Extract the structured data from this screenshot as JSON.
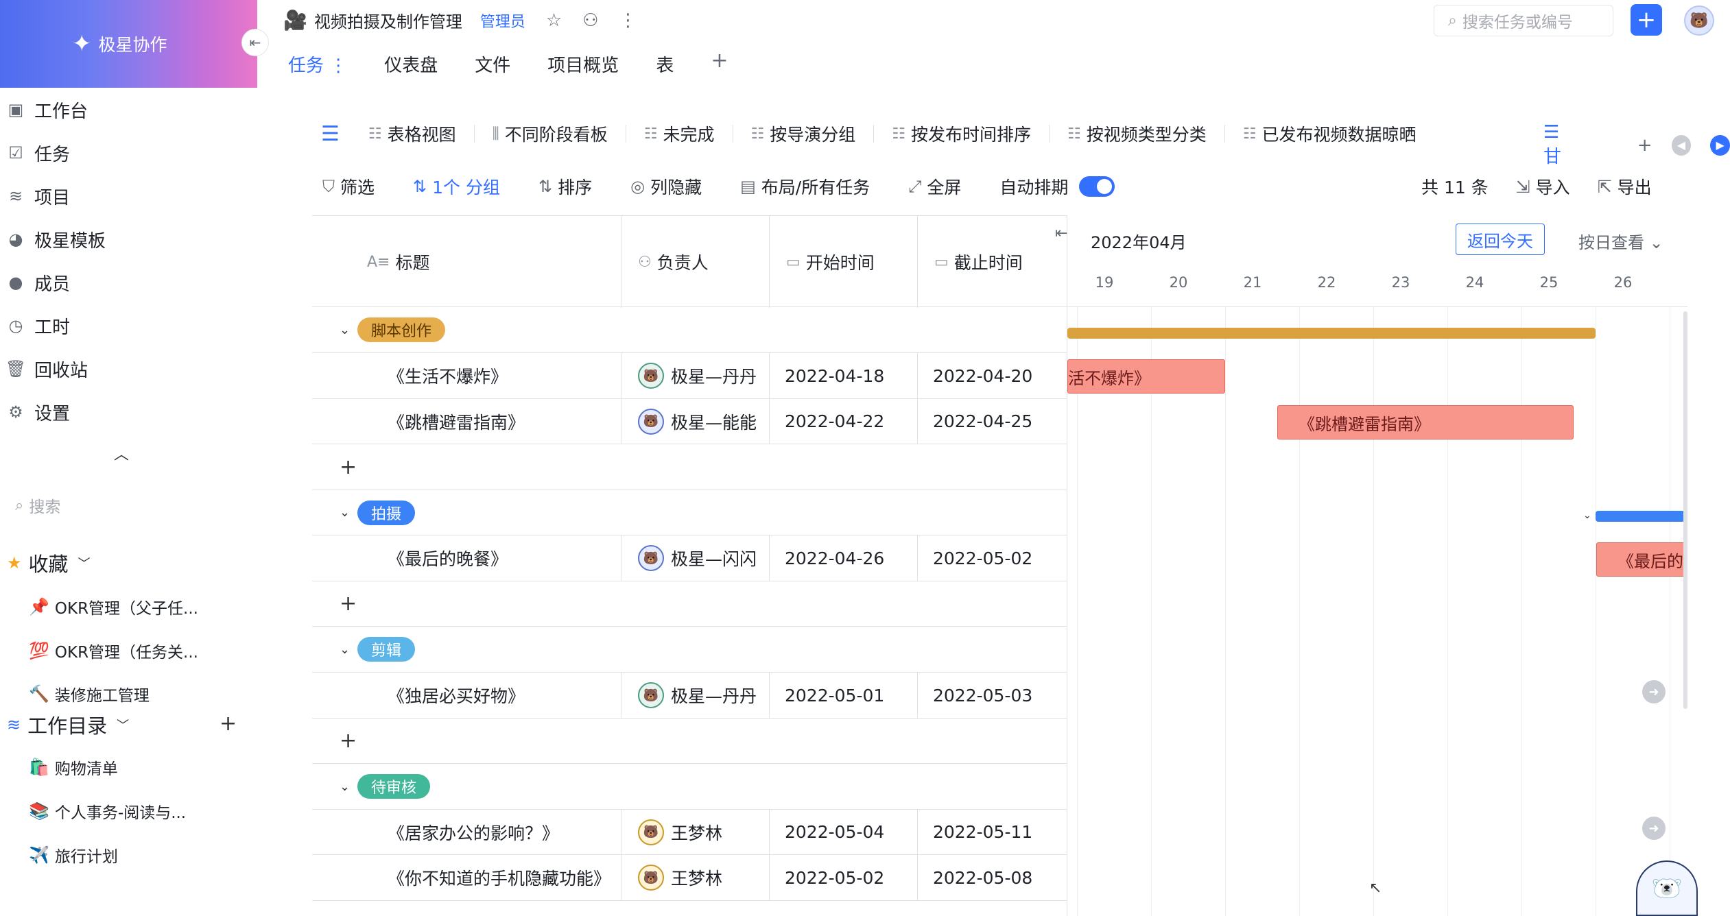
{
  "brand": {
    "name": "极星协作"
  },
  "sidebar": {
    "nav": [
      {
        "label": "工作台",
        "icon": "chart-icon"
      },
      {
        "label": "任务",
        "icon": "task-icon"
      },
      {
        "label": "项目",
        "icon": "layers-icon"
      },
      {
        "label": "极星模板",
        "icon": "template-icon"
      },
      {
        "label": "成员",
        "icon": "user-icon"
      },
      {
        "label": "工时",
        "icon": "clock-icon"
      },
      {
        "label": "回收站",
        "icon": "trash-icon"
      },
      {
        "label": "设置",
        "icon": "settings-icon"
      }
    ],
    "search_placeholder": "搜索",
    "favorites_title": "收藏",
    "favorites": [
      {
        "emoji": "📌",
        "label": "OKR管理（父子任..."
      },
      {
        "emoji": "💯",
        "label": "OKR管理（任务关..."
      },
      {
        "emoji": "🔨",
        "label": "装修施工管理"
      }
    ],
    "workdir_title": "工作目录",
    "workdir": [
      {
        "emoji": "🛍️",
        "label": "购物清单"
      },
      {
        "emoji": "📚",
        "label": "个人事务-阅读与..."
      },
      {
        "emoji": "✈️",
        "label": "旅行计划"
      }
    ]
  },
  "header": {
    "project_title": "视频拍摄及制作管理",
    "role_badge": "管理员",
    "search_placeholder": "搜索任务或编号",
    "tabs": [
      "任务 ⋮",
      "仪表盘",
      "文件",
      "项目概览",
      "表"
    ],
    "tab_add": "+"
  },
  "views": {
    "items": [
      "表格视图",
      "不同阶段看板",
      "未完成",
      "按导演分组",
      "按发布时间排序",
      "按视频类型分类",
      "已发布视频数据晾晒"
    ],
    "gantt_short": "甘",
    "add": "+"
  },
  "toolbar": {
    "filter": "筛选",
    "group": "1个 分组",
    "sort": "排序",
    "hide": "列隐藏",
    "layout": "布局/所有任务",
    "fullscreen": "全屏",
    "auto_schedule": "自动排期",
    "count": "共 11 条",
    "import": "导入",
    "export": "导出"
  },
  "table": {
    "columns": {
      "title": "标题",
      "assignee": "负责人",
      "start": "开始时间",
      "end": "截止时间"
    },
    "groups": [
      {
        "name": "脚本创作",
        "color": "#d9a23f",
        "bg": "#e6ad4c",
        "fg": "#5b3a00",
        "rows": [
          {
            "title": "《生活不爆炸》",
            "assignee": "极星—丹丹",
            "avatar": "green",
            "start": "2022-04-18",
            "end": "2022-04-20"
          },
          {
            "title": "《跳槽避雷指南》",
            "assignee": "极星—能能",
            "avatar": "blue",
            "start": "2022-04-22",
            "end": "2022-04-25"
          }
        ]
      },
      {
        "name": "拍摄",
        "color": "#3b82f6",
        "bg": "#3b82f6",
        "fg": "#ffffff",
        "rows": [
          {
            "title": "《最后的晚餐》",
            "assignee": "极星—闪闪",
            "avatar": "blue",
            "start": "2022-04-26",
            "end": "2022-05-02"
          }
        ]
      },
      {
        "name": "剪辑",
        "color": "#5bb5e8",
        "bg": "#5bb5e8",
        "fg": "#ffffff",
        "rows": [
          {
            "title": "《独居必买好物》",
            "assignee": "极星—丹丹",
            "avatar": "green",
            "start": "2022-05-01",
            "end": "2022-05-03"
          }
        ]
      },
      {
        "name": "待审核",
        "color": "#42b89a",
        "bg": "#42b89a",
        "fg": "#ffffff",
        "rows": [
          {
            "title": "《居家办公的影响？》",
            "assignee": "王梦林",
            "avatar": "yellow",
            "start": "2022-05-04",
            "end": "2022-05-11"
          },
          {
            "title": "《你不知道的手机隐藏功能》",
            "assignee": "王梦林",
            "avatar": "yellow",
            "start": "2022-05-02",
            "end": "2022-05-08"
          }
        ]
      }
    ],
    "add_row": "+"
  },
  "gantt": {
    "month": "2022年04月",
    "today_button": "返回今天",
    "view_by": "按日查看 ⌄",
    "days": [
      "19",
      "20",
      "21",
      "22",
      "23",
      "24",
      "25",
      "26"
    ],
    "bars": {
      "shenghuo": "活不爆炸》",
      "tiaocao": "《跳槽避雷指南》",
      "zuihou": "《最后的"
    },
    "colors": {
      "task_bar": "#f8968c",
      "task_border": "#e5675b",
      "script_group": "#d9a23f",
      "shoot_group": "#3b82f6"
    }
  }
}
